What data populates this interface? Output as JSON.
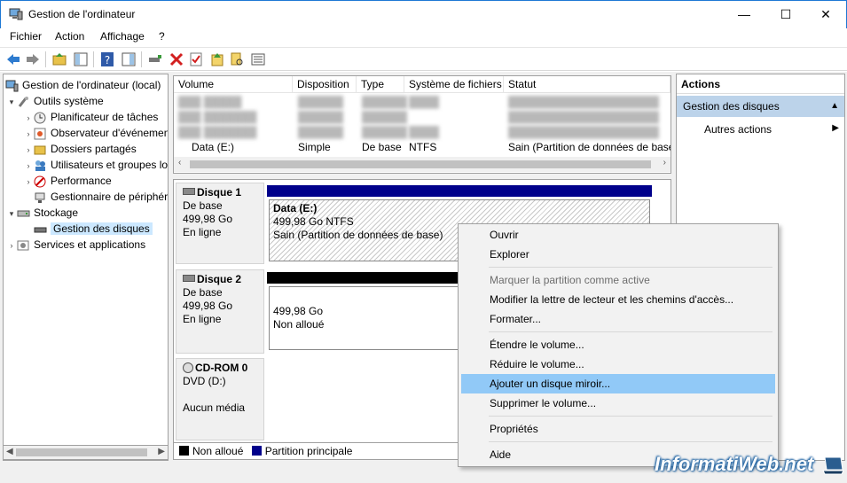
{
  "window": {
    "title": "Gestion de l'ordinateur",
    "minimize": "—",
    "maximize": "☐",
    "close": "✕"
  },
  "menu": [
    "Fichier",
    "Action",
    "Affichage",
    "?"
  ],
  "tree": {
    "root": "Gestion de l'ordinateur (local)",
    "outils": "Outils système",
    "planificateur": "Planificateur de tâches",
    "observateur": "Observateur d'événements",
    "dossiers": "Dossiers partagés",
    "utilisateurs": "Utilisateurs et groupes locaux",
    "performance": "Performance",
    "gestionnaire": "Gestionnaire de périphériques",
    "stockage": "Stockage",
    "gestion_disques": "Gestion des disques",
    "services": "Services et applications"
  },
  "volumes": {
    "headers": [
      "Volume",
      "Disposition",
      "Type",
      "Système de fichiers",
      "Statut"
    ],
    "data_row": {
      "volume": "Data (E:)",
      "disposition": "Simple",
      "type": "De base",
      "fs": "NTFS",
      "status": "Sain (Partition de données de base)"
    }
  },
  "disks": {
    "disk1": {
      "name": "Disque 1",
      "type": "De base",
      "size": "499,98 Go",
      "state": "En ligne",
      "part_name": "Data  (E:)",
      "part_size": "499,98 Go NTFS",
      "part_status": "Sain (Partition de données de base)"
    },
    "disk2": {
      "name": "Disque 2",
      "type": "De base",
      "size": "499,98 Go",
      "state": "En ligne",
      "part_size": "499,98 Go",
      "part_status": "Non alloué"
    },
    "cdrom": {
      "name": "CD-ROM 0",
      "type": "DVD (D:)",
      "state": "Aucun média"
    }
  },
  "legend": {
    "unalloc": "Non alloué",
    "primary": "Partition principale",
    "unalloc_color": "#000000",
    "primary_color": "#00008b"
  },
  "actions": {
    "header": "Actions",
    "section": "Gestion des disques",
    "more": "Autres actions"
  },
  "context_menu": {
    "ouvrir": "Ouvrir",
    "explorer": "Explorer",
    "marquer": "Marquer la partition comme active",
    "modifier": "Modifier la lettre de lecteur et les chemins d'accès...",
    "formater": "Formater...",
    "etendre": "Étendre le volume...",
    "reduire": "Réduire le volume...",
    "ajouter": "Ajouter un disque miroir...",
    "supprimer": "Supprimer le volume...",
    "proprietes": "Propriétés",
    "aide": "Aide"
  },
  "watermark": "InformatiWeb.net",
  "colors": {
    "accent": "#1e78d4",
    "highlight": "#91c9f7",
    "primary_bar": "#00008b"
  }
}
